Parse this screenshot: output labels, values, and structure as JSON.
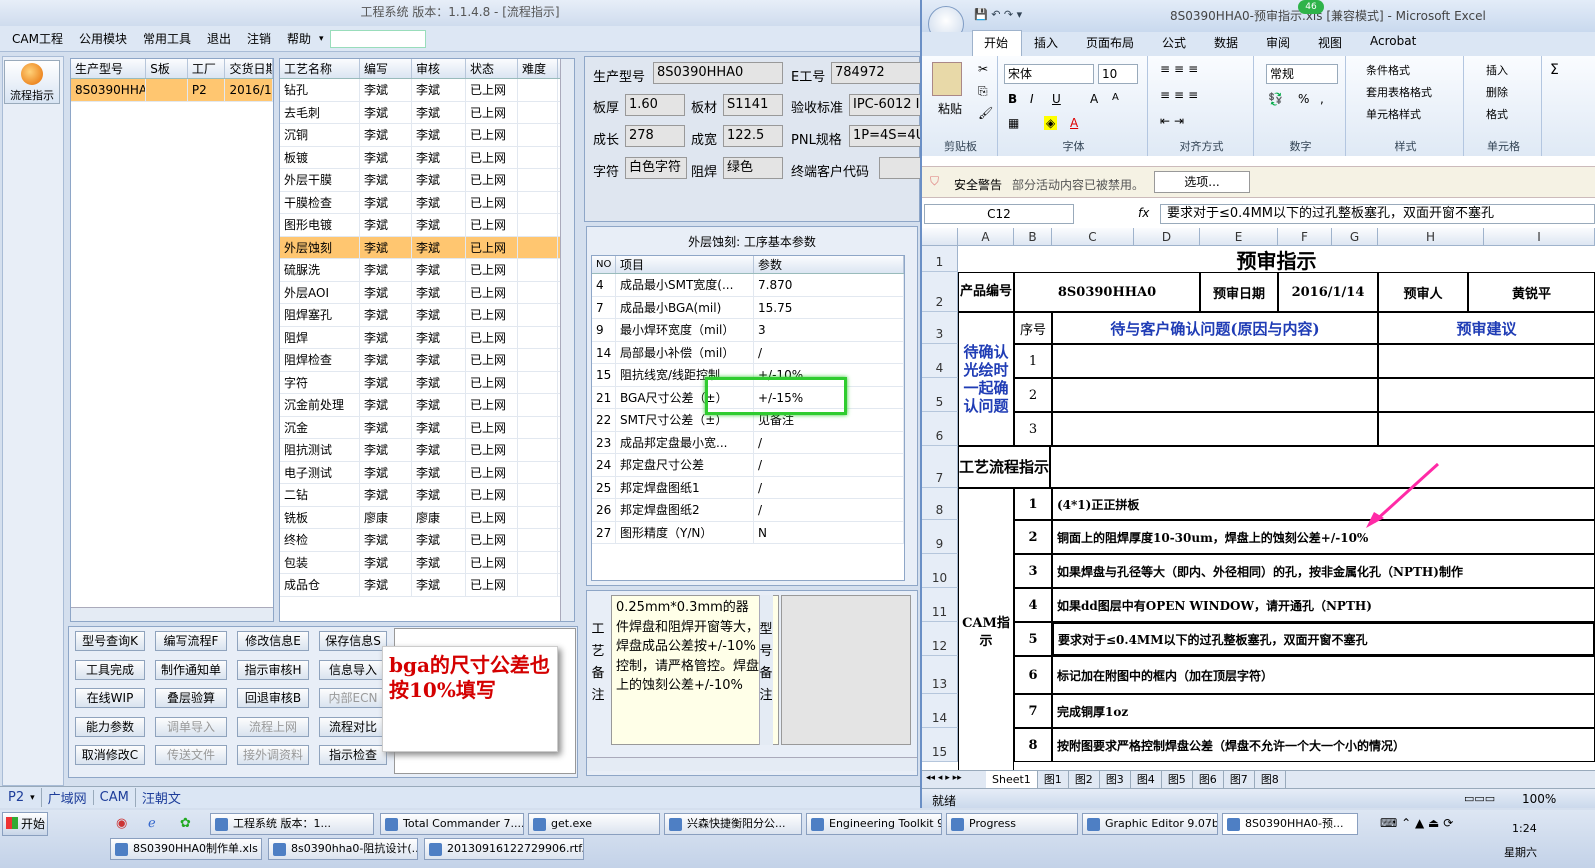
{
  "app": {
    "title": "工程系统  版本：1.1.4.8 - [流程指示]"
  },
  "menu": [
    "CAM工程",
    "公用模块",
    "常用工具",
    "退出",
    "注销",
    "帮助"
  ],
  "sidebar": {
    "flow_label": "流程指示"
  },
  "prod_grid": {
    "headers": [
      "生产型号",
      "S板",
      "工厂",
      "交货日期"
    ],
    "rows": [
      [
        "8S0390HHA0",
        "",
        "P2",
        "2016/1"
      ]
    ]
  },
  "proc_grid": {
    "headers": [
      "工艺名称",
      "编写",
      "审核",
      "状态",
      "难度"
    ],
    "rows": [
      [
        "钻孔",
        "李斌",
        "李斌",
        "已上网"
      ],
      [
        "去毛刺",
        "李斌",
        "李斌",
        "已上网"
      ],
      [
        "沉铜",
        "李斌",
        "李斌",
        "已上网"
      ],
      [
        "板镀",
        "李斌",
        "李斌",
        "已上网"
      ],
      [
        "外层干膜",
        "李斌",
        "李斌",
        "已上网"
      ],
      [
        "干膜检查",
        "李斌",
        "李斌",
        "已上网"
      ],
      [
        "图形电镀",
        "李斌",
        "李斌",
        "已上网"
      ],
      [
        "外层蚀刻",
        "李斌",
        "李斌",
        "已上网"
      ],
      [
        "硫脲洗",
        "李斌",
        "李斌",
        "已上网"
      ],
      [
        "外层AOI",
        "李斌",
        "李斌",
        "已上网"
      ],
      [
        "阻焊塞孔",
        "李斌",
        "李斌",
        "已上网"
      ],
      [
        "阻焊",
        "李斌",
        "李斌",
        "已上网"
      ],
      [
        "阻焊检查",
        "李斌",
        "李斌",
        "已上网"
      ],
      [
        "字符",
        "李斌",
        "李斌",
        "已上网"
      ],
      [
        "沉金前处理",
        "李斌",
        "李斌",
        "已上网"
      ],
      [
        "沉金",
        "李斌",
        "李斌",
        "已上网"
      ],
      [
        "阻抗测试",
        "李斌",
        "李斌",
        "已上网"
      ],
      [
        "电子测试",
        "李斌",
        "李斌",
        "已上网"
      ],
      [
        "二钻",
        "李斌",
        "李斌",
        "已上网"
      ],
      [
        "铣板",
        "廖康",
        "廖康",
        "已上网"
      ],
      [
        "终检",
        "李斌",
        "李斌",
        "已上网"
      ],
      [
        "包装",
        "李斌",
        "李斌",
        "已上网"
      ],
      [
        "成品仓",
        "李斌",
        "李斌",
        "已上网"
      ]
    ]
  },
  "info": {
    "prod_label": "生产型号",
    "prod": "8S0390HHA0",
    "e_label": "E工号",
    "e": "784972",
    "thick_label": "板厚",
    "thick": "1.60",
    "mat_label": "板材",
    "mat": "S1141",
    "std_label": "验收标准",
    "std": "IPC-6012 I",
    "len_label": "成长",
    "len": "278",
    "wid_label": "成宽",
    "wid": "122.5",
    "pnl_label": "PNL规格",
    "pnl": "1P=4S=4U",
    "char_label": "字符",
    "char": "白色字符",
    "mask_label": "阻焊",
    "mask": "绿色",
    "cust_label": "终端客户代码"
  },
  "param": {
    "title": "外层蚀刻: 工序基本参数",
    "headers": [
      "NO",
      "项目",
      "参数"
    ],
    "rows": [
      [
        "4",
        "成品最小SMT宽度(...",
        "7.870"
      ],
      [
        "7",
        "成品最小BGA(mil)",
        "15.75"
      ],
      [
        "9",
        "最小焊环宽度（mil）",
        "3"
      ],
      [
        "14",
        "局部最小补偿（mil）",
        "/"
      ],
      [
        "15",
        "阻抗线宽/线距控制...",
        "+/-10%"
      ],
      [
        "21",
        "BGA尺寸公差（±）",
        "+/-15%"
      ],
      [
        "22",
        "SMT尺寸公差（±）",
        "见备注"
      ],
      [
        "23",
        "成品邦定盘最小宽...",
        "/"
      ],
      [
        "24",
        "邦定盘尺寸公差",
        "/"
      ],
      [
        "25",
        "邦定焊盘图纸1",
        "/"
      ],
      [
        "26",
        "邦定焊盘图纸2",
        "/"
      ],
      [
        "27",
        "图形精度（Y/N）",
        "N"
      ]
    ]
  },
  "note": {
    "label": "工艺备注",
    "text": "0.25mm*0.3mm的器件焊盘和阻焊开窗等大，焊盘成品公差按+/-10%控制，请严格管控。焊盘上的蚀刻公差+/-10%",
    "model_label": "型号备注"
  },
  "annotation": "bga的尺寸公差也按10%填写",
  "buttons": [
    [
      "型号查询K",
      "编写流程F",
      "修改信息E",
      "保存信息S"
    ],
    [
      "工具完成",
      "制作通知单",
      "指示审核H",
      "信息导入"
    ],
    [
      "在线WIP",
      "叠层验算",
      "回退审核B",
      "内部ECN"
    ],
    [
      "能力参数",
      "调单导入",
      "流程上网",
      "流程对比"
    ],
    [
      "取消修改C",
      "传送文件",
      "接外调资料",
      "指示检查"
    ]
  ],
  "status_tabs": [
    "P2",
    "广域网",
    "CAM",
    "汪朝文"
  ],
  "excel": {
    "title": "8S0390HHA0-预审指示.xls [兼容模式] - Microsoft Excel",
    "badge": "46",
    "tabs": [
      "开始",
      "插入",
      "页面布局",
      "公式",
      "数据",
      "审阅",
      "视图",
      "Acrobat"
    ],
    "font": "宋体",
    "size": "10",
    "numfmt": "常规",
    "groups": [
      "剪贴板",
      "字体",
      "对齐方式",
      "数字",
      "样式",
      "单元格"
    ],
    "styles": [
      "条件格式",
      "套用表格格式",
      "单元格样式"
    ],
    "cells_cmd": [
      "插入",
      "删除",
      "格式"
    ],
    "paste": "粘贴",
    "warning": "安全警告",
    "warning_text": "部分活动内容已被禁用。",
    "options": "选项...",
    "namebox": "C12",
    "formula": "要求对于≤0.4MM以下的过孔整板塞孔，双面开窗不塞孔",
    "cols": [
      "A",
      "B",
      "C",
      "D",
      "E",
      "F",
      "G",
      "H",
      "I"
    ],
    "sheet_title": "预审指示",
    "prod_no_label": "产品编号",
    "prod_no": "8S0390HHA0",
    "date_label": "预审日期",
    "date": "2016/1/14",
    "reviewer_label": "预审人",
    "reviewer": "黄锐平",
    "seq_label": "序号",
    "issue_label": "待与客户确认问题(原因与内容)",
    "suggest_label": "预审建议",
    "confirm_label": "待确认光绘时一起确认问题",
    "flow_label": "工艺流程指示",
    "cam_label": "CAM指示",
    "items": [
      "(4*1)正正拼板",
      "铜面上的阻焊厚度10-30um，焊盘上的蚀刻公差+/-10%",
      "如果焊盘与孔径等大（即内、外径相同）的孔，按非金属化孔（NPTH)制作",
      "如果dd图层中有OPEN WINDOW，请开通孔（NPTH)",
      "要求对于≤0.4MM以下的过孔整板塞孔，双面开窗不塞孔",
      "标记加在附图中的框内（加在顶层字符）",
      "完成铜厚1oz",
      "按附图要求严格控制焊盘公差（焊盘不允许一个大一个小的情况）"
    ],
    "sheets": [
      "Sheet1",
      "图1",
      "图2",
      "图3",
      "图4",
      "图5",
      "图6",
      "图7",
      "图8"
    ],
    "status": "就绪",
    "zoom": "100%"
  },
  "taskbar": {
    "start": "开始",
    "items": [
      "工程系统  版本：1...",
      "Total Commander 7....",
      "get.exe",
      "兴森快捷衡阳分公...",
      "Engineering Toolkit 9...",
      "Progress",
      "Graphic Editor 9.07b...",
      "8S0390HHA0-预..."
    ],
    "items2": [
      "8S0390HHA0制作单.xls ...",
      "8s0390hha0-阻抗设计(...",
      "20130916122729906.rtf..."
    ],
    "time": "1:24",
    "weekday": "星期六"
  },
  "colors": {
    "highlight": "#ffc670",
    "green_box": "#2fcc2f",
    "arrow": "#ff2aa6",
    "annot": "#d40000"
  }
}
